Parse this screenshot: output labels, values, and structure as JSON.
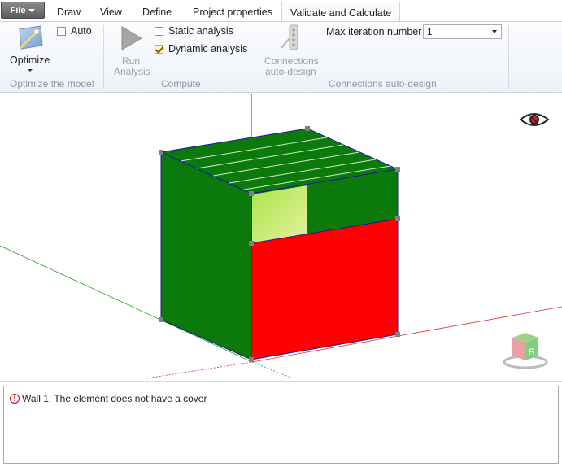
{
  "file_menu": {
    "label": "File"
  },
  "tabs": [
    {
      "label": "Draw"
    },
    {
      "label": "View"
    },
    {
      "label": "Define"
    },
    {
      "label": "Project properties"
    },
    {
      "label": "Validate and Calculate",
      "active": true
    }
  ],
  "ribbon": {
    "optimize_group": {
      "optimize_label": "Optimize",
      "auto_label": "Auto",
      "auto_checked": false,
      "group_label": "Optimize the model"
    },
    "compute_group": {
      "run_label_1": "Run",
      "run_label_2": "Analysis",
      "static_label": "Static analysis",
      "static_checked": false,
      "dynamic_label": "Dynamic analysis",
      "dynamic_checked": true,
      "group_label": "Compute"
    },
    "connections_group": {
      "connections_label_1": "Connections",
      "connections_label_2": "auto-design",
      "max_iter_label": "Max iteration number",
      "max_iter_value": "1",
      "group_label": "Connections auto-design"
    }
  },
  "viewport": {
    "visibility_icon": "eye-hidden-icon",
    "orientation_cube_label": "R",
    "colors": {
      "wall_green": "#0b7a0b",
      "wall_red": "#ff0000",
      "highlight": "#b8e05a",
      "axis_x": "#e03030",
      "axis_y": "#2ea02e",
      "axis_z": "#2a2ad8"
    }
  },
  "messages": {
    "items": [
      {
        "icon": "error-icon",
        "text": "Wall 1: The element does not have a cover"
      }
    ]
  }
}
